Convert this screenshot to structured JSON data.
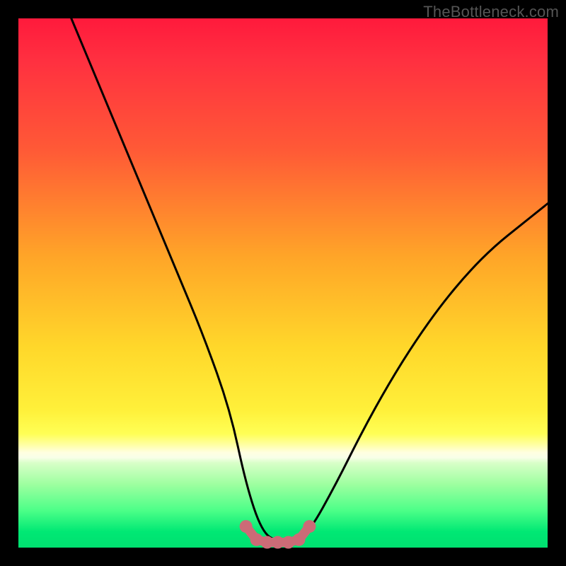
{
  "watermark": "TheBottleneck.com",
  "colors": {
    "frame": "#000000",
    "grad_top": "#ff1a3c",
    "grad_mid": "#ffd72a",
    "grad_bottom": "#00e070",
    "curve": "#000000",
    "marker": "#cc6b77"
  },
  "chart_data": {
    "type": "line",
    "title": "",
    "xlabel": "",
    "ylabel": "",
    "xlim": [
      0,
      100
    ],
    "ylim": [
      0,
      100
    ],
    "series": [
      {
        "name": "bottleneck-curve",
        "x": [
          10,
          15,
          20,
          25,
          30,
          35,
          40,
          43,
          46,
          49,
          52,
          55,
          60,
          65,
          70,
          75,
          80,
          85,
          90,
          95,
          100
        ],
        "y": [
          100,
          88,
          76,
          64,
          52,
          40,
          26,
          12,
          3,
          1,
          1,
          3,
          12,
          22,
          31,
          39,
          46,
          52,
          57,
          61,
          65
        ]
      }
    ],
    "markers": {
      "name": "floor-segment",
      "color": "#cc6b77",
      "x": [
        43,
        45,
        47,
        49,
        51,
        53,
        55
      ],
      "y": [
        4,
        1.5,
        1,
        1,
        1,
        1.5,
        4
      ]
    }
  }
}
